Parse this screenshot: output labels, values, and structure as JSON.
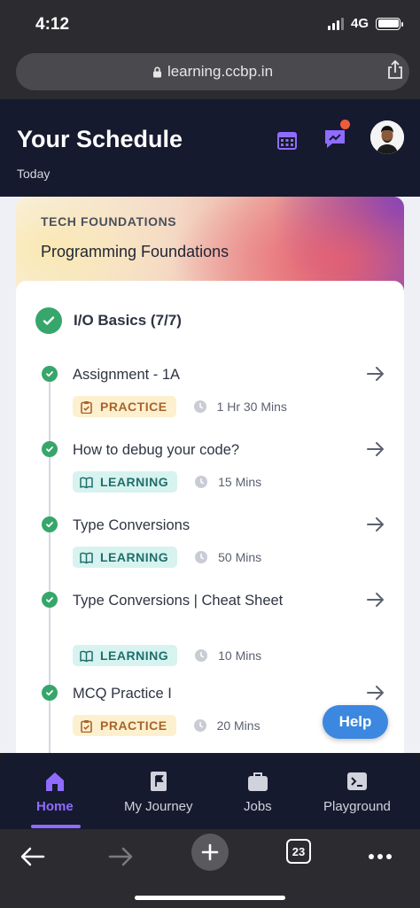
{
  "status_bar": {
    "time": "4:12",
    "network": "4G"
  },
  "browser": {
    "url": "learning.ccbp.in",
    "tab_count": "23"
  },
  "header": {
    "title": "Your Schedule",
    "subtitle": "Today"
  },
  "course": {
    "tag": "TECH FOUNDATIONS",
    "name": "Programming Foundations"
  },
  "module": {
    "title": "I/O Basics (7/7)",
    "items": [
      {
        "title": "Assignment - 1A",
        "type": "PRACTICE",
        "duration": "1 Hr 30 Mins"
      },
      {
        "title": "How to debug your code?",
        "type": "LEARNING",
        "duration": "15 Mins"
      },
      {
        "title": "Type Conversions",
        "type": "LEARNING",
        "duration": "50 Mins"
      },
      {
        "title": "Type Conversions | Cheat Sheet",
        "type": "LEARNING",
        "duration": "10 Mins"
      },
      {
        "title": "MCQ Practice I",
        "type": "PRACTICE",
        "duration": "20 Mins"
      }
    ]
  },
  "help_label": "Help",
  "nav": {
    "items": [
      {
        "label": "Home",
        "icon": "home-icon",
        "active": true
      },
      {
        "label": "My Journey",
        "icon": "flag-icon",
        "active": false
      },
      {
        "label": "Jobs",
        "icon": "briefcase-icon",
        "active": false
      },
      {
        "label": "Playground",
        "icon": "terminal-icon",
        "active": false
      }
    ]
  },
  "colors": {
    "accent": "#8f6cff",
    "header_bg": "#151a2e",
    "success": "#37a66b",
    "practice_bg": "#fdf0cf",
    "practice_text": "#a8642a",
    "learning_bg": "#d7f3f0",
    "learning_text": "#1f6e6b",
    "help_button": "#3c87e0"
  }
}
